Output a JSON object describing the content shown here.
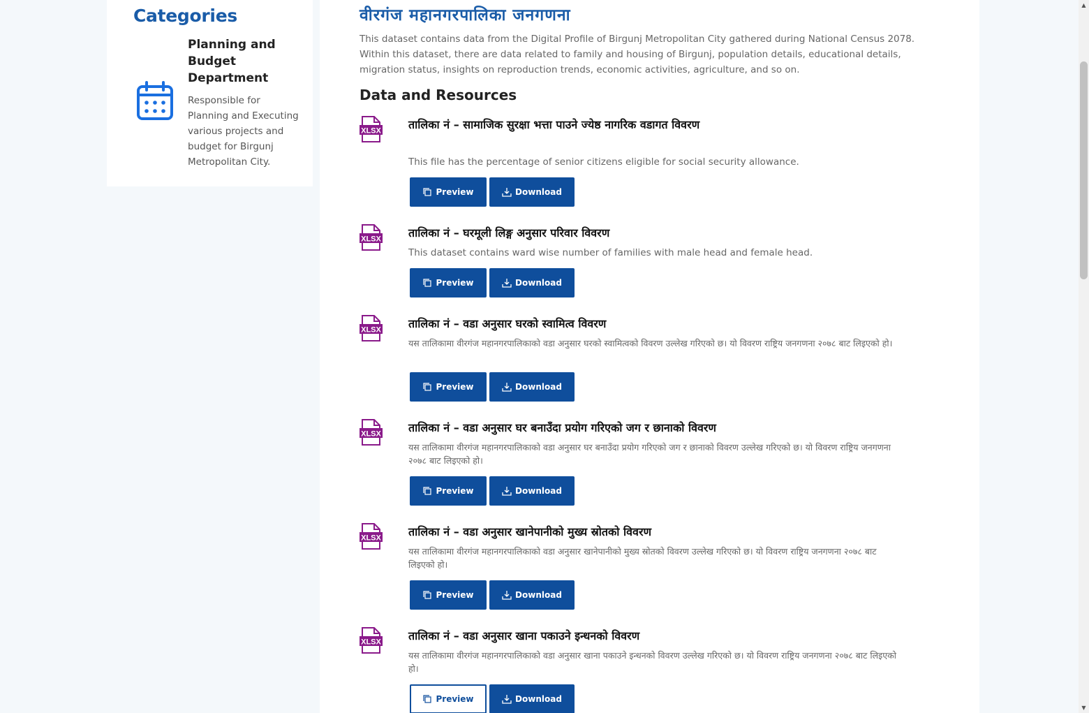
{
  "sidebar": {
    "heading": "Categories",
    "organization": {
      "name": "Planning and Budget Department",
      "description": "Responsible for Planning and Executing various projects and budget for Birgunj Metropolitan City.",
      "icon": "calendar-icon"
    }
  },
  "dataset": {
    "title": "वीरगंज महानगरपालिका जनगणना",
    "description": "This dataset contains data from the Digital Profile of Birgunj Metropolitan City gathered during National Census 2078. Within this dataset, there are data related to family and housing of Birgunj, population details, educational details, migration status, insights on reproduction trends, economic activities, agriculture, and so on.",
    "resources_heading": "Data and Resources"
  },
  "resources": [
    {
      "title": "तालिका नं – सामाजिक सुरक्षा भत्ता पाउने ज्येष्ठ नागरिक वडागत विवरण",
      "description": "This file has the percentage of senior citizens eligible for social security allowance.",
      "format": "XLSX",
      "preview_label": "Preview",
      "download_label": "Download"
    },
    {
      "title": "तालिका नं – घरमूली लिङ्ग अनुसार परिवार विवरण",
      "description": "This dataset contains ward wise number of families with male head and female head.",
      "format": "XLSX",
      "preview_label": "Preview",
      "download_label": "Download"
    },
    {
      "title": "तालिका नं – वडा अनुसार घरको स्वामित्व विवरण",
      "description": "यस तालिकामा वीरगंज महानगरपालिकाको वडा अनुसार घरको स्वामित्वको विवरण उल्लेख गरिएको छ। यो विवरण राष्ट्रिय जनगणना २०७८ बाट लिइएको हो।",
      "format": "XLSX",
      "preview_label": "Preview",
      "download_label": "Download"
    },
    {
      "title": "तालिका नं – वडा अनुसार घर बनाउँदा प्रयोग गरिएको जग र छानाको विवरण",
      "description": "यस तालिकामा वीरगंज महानगरपालिकाको वडा अनुसार घर बनाउँदा प्रयोग गरिएको जग र छानाको विवरण उल्लेख गरिएको छ। यो विवरण राष्ट्रिय जनगणना २०७८ बाट लिइएको हो।",
      "format": "XLSX",
      "preview_label": "Preview",
      "download_label": "Download"
    },
    {
      "title": "तालिका नं – वडा अनुसार खानेपानीको मुख्य स्रोतको विवरण",
      "description": "यस तालिकामा वीरगंज महानगरपालिकाको वडा अनुसार खानेपानीको मुख्य स्रोतको विवरण उल्लेख गरिएको छ। यो विवरण राष्ट्रिय जनगणना २०७८ बाट लिइएको हो।",
      "format": "XLSX",
      "preview_label": "Preview",
      "download_label": "Download"
    },
    {
      "title": "तालिका नं – वडा अनुसार खाना पकाउने इन्धनको विवरण",
      "description": "यस तालिकामा वीरगंज महानगरपालिकाको वडा अनुसार खाना पकाउने इन्धनको विवरण उल्लेख गरिएको छ। यो विवरण राष्ट्रिय जनगणना २०७८ बाट लिइएको हो।",
      "format": "XLSX",
      "preview_label": "Preview",
      "download_label": "Download"
    }
  ],
  "colors": {
    "brand_blue": "#0f4e9c",
    "heading_blue": "#1a5ca8",
    "xlsx_purple": "#8a1a8a",
    "calendar_blue": "#1a6fe0"
  }
}
